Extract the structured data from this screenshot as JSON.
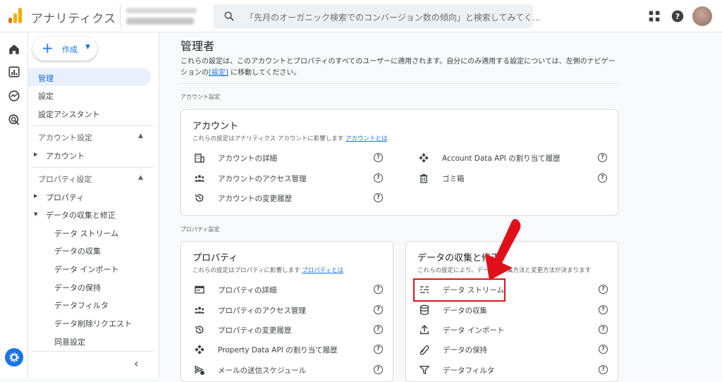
{
  "header": {
    "app_title": "アナリティクス",
    "search_placeholder": "「先月のオーガニック検索でのコンバージョン数の傾向」と検索してみてく..."
  },
  "rail": {
    "icons": [
      "home-icon",
      "reports-icon",
      "explore-icon",
      "advertising-icon"
    ]
  },
  "sidenav": {
    "create_label": "作成",
    "items": {
      "admin": "管理",
      "settings": "設定",
      "setup_assistant": "設定アシスタント"
    },
    "account_section": {
      "header": "アカウント設定",
      "account": "アカウント"
    },
    "property_section": {
      "header": "プロパティ設定",
      "property": "プロパティ",
      "data_collection": "データの収集と修正",
      "sub": [
        "データ ストリーム",
        "データの収集",
        "データ インポート",
        "データの保持",
        "データフィルタ",
        "データ削除リクエスト"
      ],
      "consent": "同意設定"
    }
  },
  "main": {
    "title": "管理者",
    "desc_line1": "これらの設定は、このアカウントとプロパティのすべてのユーザーに適用されます。自分にのみ適用する設定については、左側のナビゲー",
    "desc_pre": "ションの",
    "desc_link": "[設定]",
    "desc_post": " に移動してください。",
    "account_settings_label": "アカウント設定",
    "property_settings_label": "プロパティ設定",
    "account_card": {
      "title": "アカウント",
      "sub": "これらの設定はアナリティクス アカウントに影響します",
      "sub_link": "アカウントとは",
      "rows": [
        "アカウントの詳細",
        "アカウントのアクセス管理",
        "アカウントの変更履歴",
        "Account Data API の割り当て履歴",
        "ゴミ箱"
      ]
    },
    "property_card": {
      "title": "プロパティ",
      "sub": "これらの設定はプロパティに影響します",
      "sub_link": "プロパティとは",
      "rows": [
        "プロパティの詳細",
        "プロパティのアクセス管理",
        "プロパティの変更履歴",
        "Property Data API の割り当て履歴",
        "メールの送信スケジュール"
      ]
    },
    "data_card": {
      "title": "データの収集と修正",
      "sub": "これらの設定により、データの収集方法と変更方法が決まります",
      "rows": [
        "データ ストリーム",
        "データの収集",
        "データ インポート",
        "データの保持",
        "データフィルタ"
      ]
    },
    "help_glyph": "?"
  },
  "colors": {
    "accent": "#1a73e8",
    "highlight": "#e0101b",
    "logo_orange": "#f9ab00",
    "logo_dark": "#e37400"
  }
}
